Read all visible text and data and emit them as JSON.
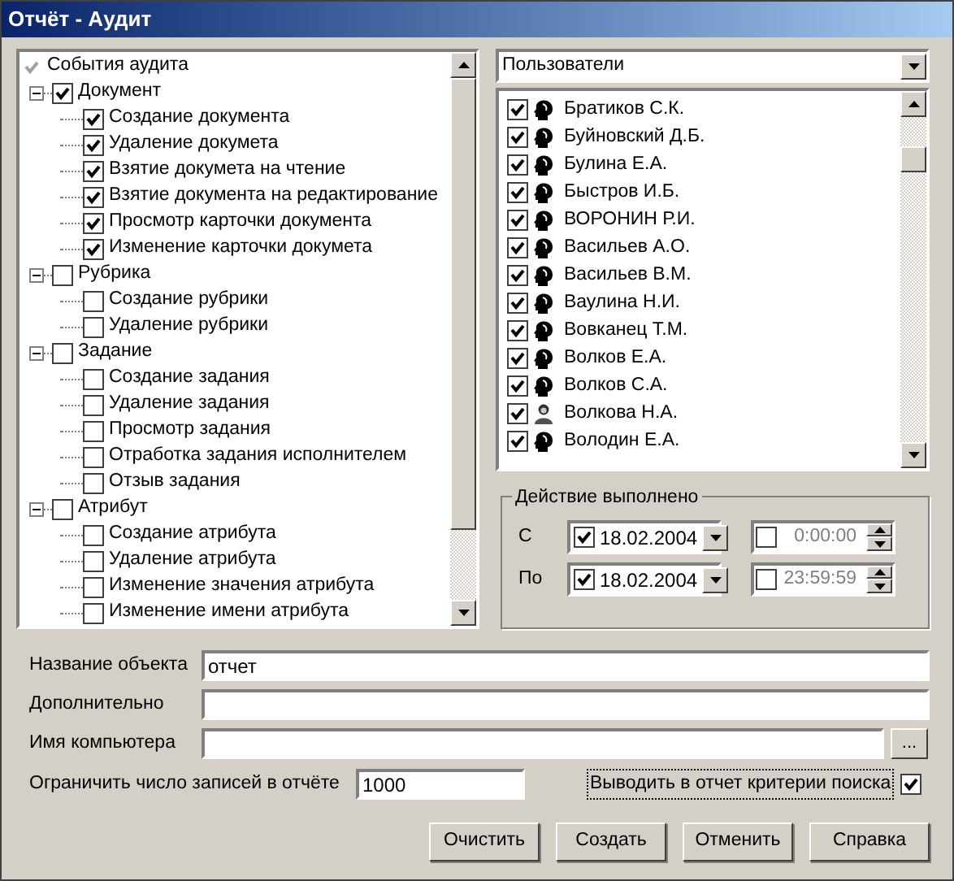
{
  "window": {
    "title": "Отчёт - Аудит"
  },
  "event_tree": {
    "label": "События аудита",
    "checked": true,
    "partial": true,
    "children": [
      {
        "label": "Документ",
        "checked": true,
        "expanded": true,
        "children": [
          {
            "label": "Создание документа",
            "checked": true
          },
          {
            "label": "Удаление докумета",
            "checked": true
          },
          {
            "label": "Взятие докумета на чтение",
            "checked": true
          },
          {
            "label": "Взятие документа на редактирование",
            "checked": true
          },
          {
            "label": "Просмотр карточки документа",
            "checked": true
          },
          {
            "label": "Изменение карточки докумета",
            "checked": true
          }
        ]
      },
      {
        "label": "Рубрика",
        "checked": false,
        "expanded": true,
        "children": [
          {
            "label": "Создание рубрики",
            "checked": false
          },
          {
            "label": "Удаление рубрики",
            "checked": false
          }
        ]
      },
      {
        "label": "Задание",
        "checked": false,
        "expanded": true,
        "children": [
          {
            "label": "Создание задания",
            "checked": false
          },
          {
            "label": "Удаление задания",
            "checked": false
          },
          {
            "label": "Просмотр задания",
            "checked": false
          },
          {
            "label": "Отработка задания исполнителем",
            "checked": false
          },
          {
            "label": "Отзыв задания",
            "checked": false
          }
        ]
      },
      {
        "label": "Атрибут",
        "checked": false,
        "expanded": true,
        "children": [
          {
            "label": "Создание атрибута",
            "checked": false
          },
          {
            "label": "Удаление атрибута",
            "checked": false
          },
          {
            "label": "Изменение значения атрибута",
            "checked": false
          },
          {
            "label": "Изменение имени атрибута",
            "checked": false
          }
        ]
      }
    ]
  },
  "subject_combo": {
    "value": "Пользователи"
  },
  "users": [
    {
      "name": "Братиков С.К.",
      "checked": true,
      "kind": "user"
    },
    {
      "name": "Буйновский Д.Б.",
      "checked": true,
      "kind": "user"
    },
    {
      "name": "Булина Е.А.",
      "checked": true,
      "kind": "user"
    },
    {
      "name": "Быстров И.Б.",
      "checked": true,
      "kind": "user"
    },
    {
      "name": "ВОРОНИН Р.И.",
      "checked": true,
      "kind": "user"
    },
    {
      "name": "Васильев А.О.",
      "checked": true,
      "kind": "user"
    },
    {
      "name": "Васильев В.М.",
      "checked": true,
      "kind": "user"
    },
    {
      "name": "Ваулина Н.И.",
      "checked": true,
      "kind": "user"
    },
    {
      "name": "Вовканец Т.М.",
      "checked": true,
      "kind": "user"
    },
    {
      "name": "Волков Е.А.",
      "checked": true,
      "kind": "user"
    },
    {
      "name": "Волков С.А.",
      "checked": true,
      "kind": "user"
    },
    {
      "name": "Волкова Н.А.",
      "checked": true,
      "kind": "admin"
    },
    {
      "name": "Володин Е.А.",
      "checked": true,
      "kind": "user"
    }
  ],
  "action_done": {
    "title": "Действие выполнено",
    "rows": [
      {
        "label": "С",
        "date_checked": true,
        "date": "18.02.2004",
        "time_checked": false,
        "time": "0:00:00"
      },
      {
        "label": "По",
        "date_checked": true,
        "date": "18.02.2004",
        "time_checked": false,
        "time": "23:59:59"
      }
    ]
  },
  "fields": [
    {
      "label": "Название объекта",
      "value": "отчет",
      "kind": "text"
    },
    {
      "label": "Дополнительно",
      "kind": "text"
    },
    {
      "label": "Имя компьютера",
      "kind": "browse",
      "button": "..."
    }
  ],
  "limit": {
    "label": "Ограничить число записей в отчёте",
    "value": "1000"
  },
  "print_criteria": {
    "label": "Выводить в отчет критерии поиска",
    "checked": true
  },
  "buttons": [
    "Очистить",
    "Создать",
    "Отменить",
    "Справка"
  ]
}
